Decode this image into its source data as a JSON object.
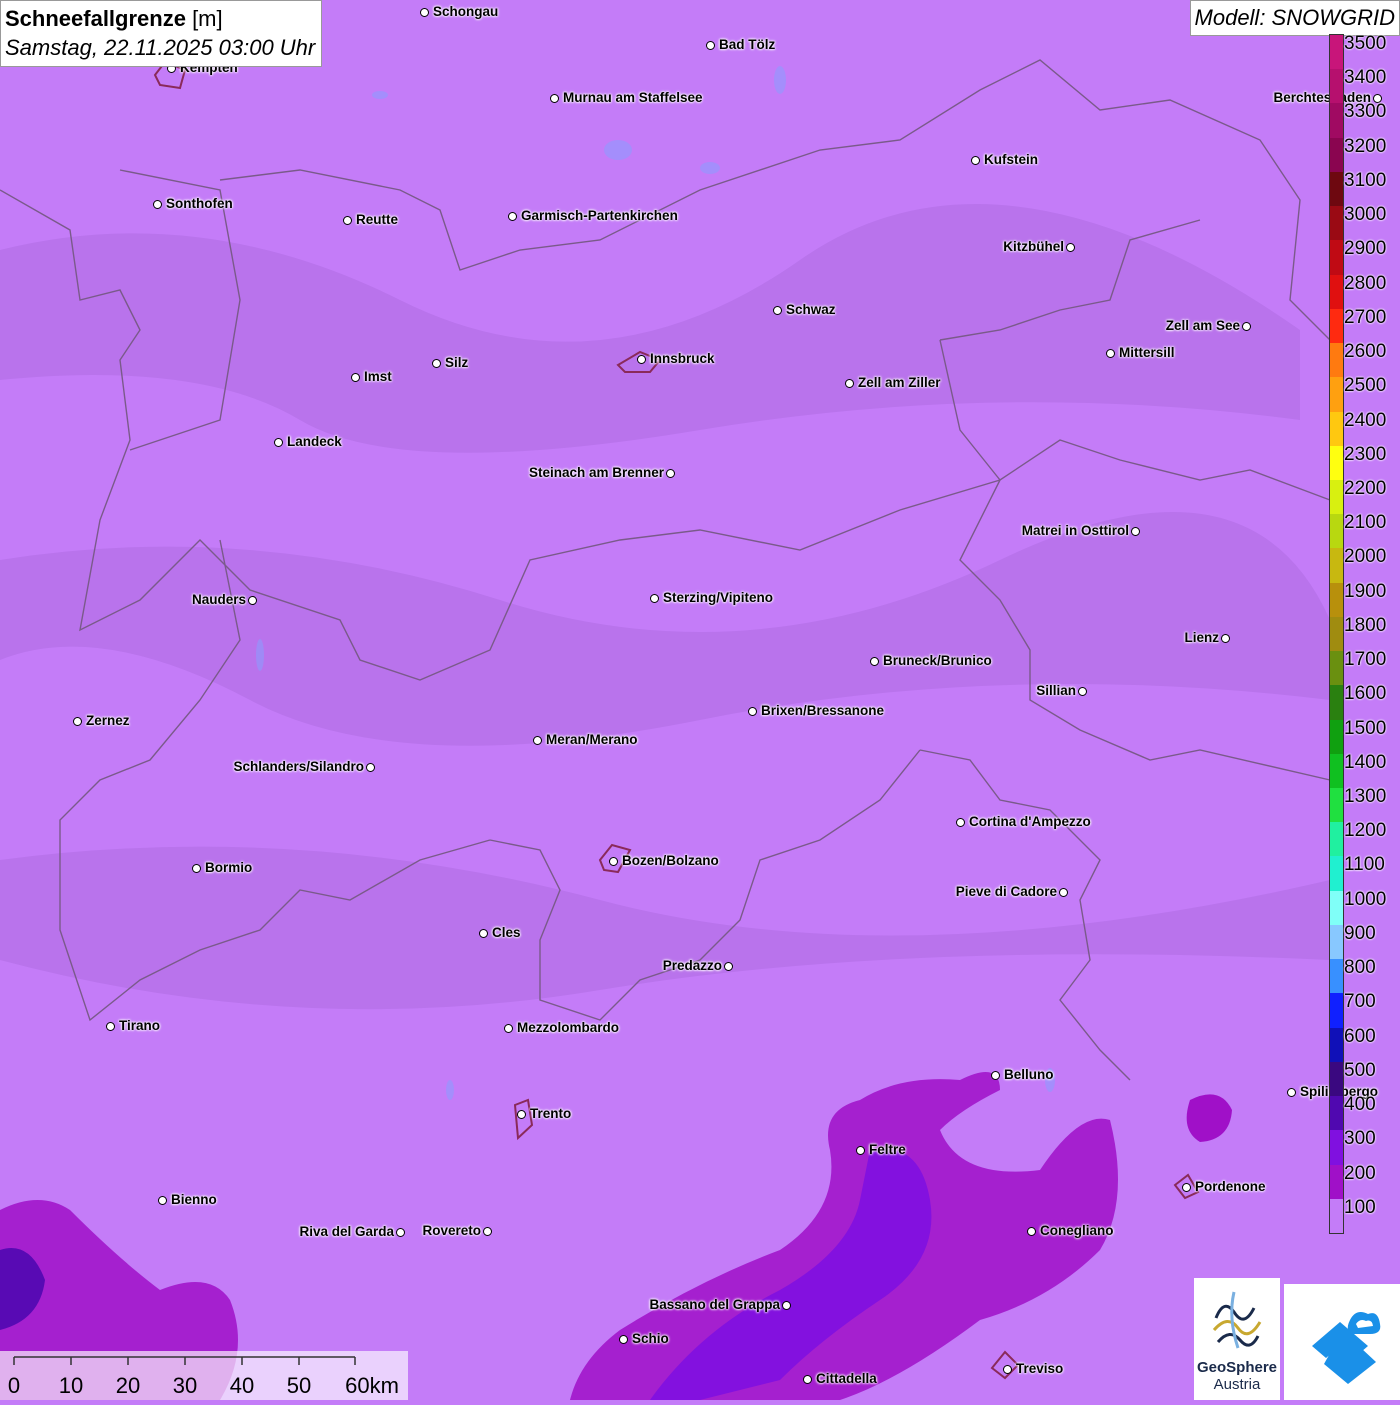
{
  "header": {
    "title_bold": "Schneefallgrenze",
    "title_unit": " [m]",
    "date": "Samstag, 22.11.2025 03:00 Uhr"
  },
  "model_label": "Modell: SNOWGRID",
  "legend": {
    "labels": [
      "3500",
      "3400",
      "3300",
      "3200",
      "3100",
      "3000",
      "2900",
      "2800",
      "2700",
      "2600",
      "2500",
      "2400",
      "2300",
      "2200",
      "2100",
      "2000",
      "1900",
      "1800",
      "1700",
      "1600",
      "1500",
      "1400",
      "1300",
      "1200",
      "1100",
      "1000",
      "900",
      "800",
      "700",
      "600",
      "500",
      "400",
      "300",
      "200",
      "100"
    ],
    "colors": [
      "#c8157a",
      "#b6106e",
      "#a00a62",
      "#8a0550",
      "#6e0810",
      "#9a0a14",
      "#c00a14",
      "#e01010",
      "#ff2a10",
      "#ff7a10",
      "#ffa010",
      "#ffc810",
      "#ffff10",
      "#d8f010",
      "#b8d810",
      "#c8b810",
      "#b8900c",
      "#a08c10",
      "#6a9010",
      "#2a8010",
      "#10a010",
      "#10c020",
      "#20e040",
      "#20f0a0",
      "#20f0d0",
      "#80fff8",
      "#88c8ff",
      "#3890ff",
      "#1020ff",
      "#1010b8",
      "#3a0880",
      "#5008b0",
      "#8010e0",
      "#a010c8",
      "#c47cf8"
    ]
  },
  "map": {
    "background_color": "#c47cf8",
    "cities": [
      {
        "name": "Schongau",
        "side": "right"
      },
      {
        "name": "Bad Tölz",
        "side": "right"
      },
      {
        "name": "Kempten",
        "side": "right"
      },
      {
        "name": "Murnau am Staffelsee",
        "side": "right"
      },
      {
        "name": "Kufstein",
        "side": "right"
      },
      {
        "name": "Berchtesgaden",
        "side": "left"
      },
      {
        "name": "Sonthofen",
        "side": "right"
      },
      {
        "name": "Reutte",
        "side": "right"
      },
      {
        "name": "Garmisch-Partenkirchen",
        "side": "right"
      },
      {
        "name": "Kitzbühel",
        "side": "left"
      },
      {
        "name": "Schwaz",
        "side": "right"
      },
      {
        "name": "Zell am See",
        "side": "left"
      },
      {
        "name": "Mittersill",
        "side": "right"
      },
      {
        "name": "Innsbruck",
        "side": "right"
      },
      {
        "name": "Imst",
        "side": "right"
      },
      {
        "name": "Silz",
        "side": "right"
      },
      {
        "name": "Zell am Ziller",
        "side": "right"
      },
      {
        "name": "Landeck",
        "side": "right"
      },
      {
        "name": "Steinach am Brenner",
        "side": "left"
      },
      {
        "name": "Matrei in Osttirol",
        "side": "left"
      },
      {
        "name": "Nauders",
        "side": "left"
      },
      {
        "name": "Sterzing/Vipiteno",
        "side": "right"
      },
      {
        "name": "Lienz",
        "side": "left"
      },
      {
        "name": "Bruneck/Brunico",
        "side": "right"
      },
      {
        "name": "Sillian",
        "side": "left"
      },
      {
        "name": "Zernez",
        "side": "right"
      },
      {
        "name": "Brixen/Bressanone",
        "side": "right"
      },
      {
        "name": "Meran/Merano",
        "side": "right"
      },
      {
        "name": "Schlanders/Silandro",
        "side": "left"
      },
      {
        "name": "Cortina d'Ampezzo",
        "side": "right"
      },
      {
        "name": "Bozen/Bolzano",
        "side": "right"
      },
      {
        "name": "Bormio",
        "side": "right"
      },
      {
        "name": "Pieve di Cadore",
        "side": "left"
      },
      {
        "name": "Cles",
        "side": "right"
      },
      {
        "name": "Predazzo",
        "side": "left"
      },
      {
        "name": "Tirano",
        "side": "right"
      },
      {
        "name": "Mezzolombardo",
        "side": "right"
      },
      {
        "name": "Belluno",
        "side": "right"
      },
      {
        "name": "Spilimbergo",
        "side": "right"
      },
      {
        "name": "Trento",
        "side": "right"
      },
      {
        "name": "Feltre",
        "side": "right"
      },
      {
        "name": "Pordenone",
        "side": "right"
      },
      {
        "name": "Bienno",
        "side": "right"
      },
      {
        "name": "Riva del Garda",
        "side": "left"
      },
      {
        "name": "Rovereto",
        "side": "left"
      },
      {
        "name": "Conegliano",
        "side": "right"
      },
      {
        "name": "Bassano del Grappa",
        "side": "left"
      },
      {
        "name": "Schio",
        "side": "right"
      },
      {
        "name": "Treviso",
        "side": "right"
      },
      {
        "name": "Cittadella",
        "side": "right"
      }
    ]
  },
  "scalebar": {
    "ticks": [
      "0",
      "10",
      "20",
      "30",
      "40",
      "50",
      "60km"
    ]
  },
  "logos": {
    "geosphere_line1": "GeoSphere",
    "geosphere_line2": "Austria"
  }
}
